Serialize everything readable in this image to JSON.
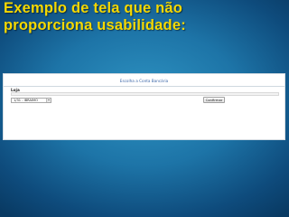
{
  "slide": {
    "title_line1": "Exemplo de tela que não",
    "title_line2": "proporciona usabilidade:"
  },
  "form": {
    "heading": "Escolha a Conta Bancária",
    "field_label": "Loja",
    "select_value": "1/31 - IBRAIMO",
    "confirm_label": "Confirmar"
  },
  "colors": {
    "title": "#f5d800",
    "heading": "#3b66a8",
    "background": "#1d74a7"
  }
}
